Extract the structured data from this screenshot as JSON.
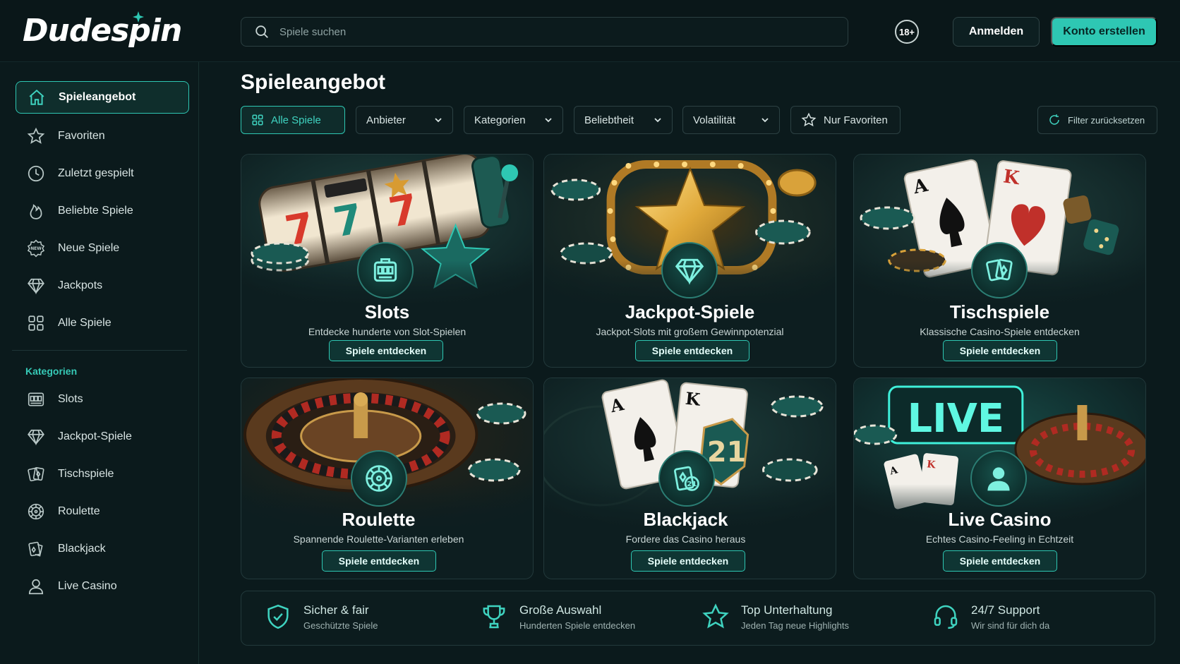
{
  "header": {
    "logo": "Dudespin",
    "search_placeholder": "Spiele suchen",
    "age_badge": "18+",
    "login_label": "Anmelden",
    "register_label": "Konto erstellen"
  },
  "sidebar": {
    "items": [
      {
        "label": "Spieleangebot",
        "icon": "home-icon",
        "active": true
      },
      {
        "label": "Favoriten",
        "icon": "star-icon"
      },
      {
        "label": "Zuletzt gespielt",
        "icon": "clock-icon"
      },
      {
        "label": "Beliebte Spiele",
        "icon": "flame-icon"
      },
      {
        "label": "Neue Spiele",
        "icon": "new-badge-icon"
      },
      {
        "label": "Jackpots",
        "icon": "diamond-icon"
      },
      {
        "label": "Alle Spiele",
        "icon": "grid-icon"
      }
    ],
    "section_title": "Kategorien",
    "categories": [
      {
        "label": "Slots",
        "icon": "slot-machine-icon"
      },
      {
        "label": "Jackpot-Spiele",
        "icon": "diamond-icon"
      },
      {
        "label": "Tischspiele",
        "icon": "cards-icon"
      },
      {
        "label": "Roulette",
        "icon": "roulette-icon"
      },
      {
        "label": "Blackjack",
        "icon": "blackjack-icon"
      },
      {
        "label": "Live Casino",
        "icon": "user-icon"
      }
    ]
  },
  "main": {
    "title": "Spieleangebot",
    "filters": {
      "all_games": "Alle Spiele",
      "provider": "Anbieter",
      "categories": "Kategorien",
      "popularity": "Beliebtheit",
      "volatility": "Volatilität",
      "favorites_only": "Nur Favoriten",
      "reset": "Filter zurücksetzen"
    },
    "cards": [
      {
        "title": "Slots",
        "subtitle": "Entdecke hunderte von Slot-Spielen",
        "cta": "Spiele entdecken",
        "icon": "slot-machine-icon"
      },
      {
        "title": "Jackpot-Spiele",
        "subtitle": "Jackpot-Slots mit großem Gewinnpotenzial",
        "cta": "Spiele entdecken",
        "icon": "diamond-icon"
      },
      {
        "title": "Tischspiele",
        "subtitle": "Klassische Casino-Spiele entdecken",
        "cta": "Spiele entdecken",
        "icon": "cards-icon"
      },
      {
        "title": "Roulette",
        "subtitle": "Spannende Roulette-Varianten erleben",
        "cta": "Spiele entdecken",
        "icon": "roulette-icon"
      },
      {
        "title": "Blackjack",
        "subtitle": "Fordere das Casino heraus",
        "cta": "Spiele entdecken",
        "icon": "blackjack-icon",
        "art_text": "21"
      },
      {
        "title": "Live Casino",
        "subtitle": "Echtes Casino-Feeling in Echtzeit",
        "cta": "Spiele entdecken",
        "icon": "user-icon",
        "art_text": "LIVE"
      }
    ]
  },
  "features": [
    {
      "title": "Sicher & fair",
      "subtitle": "Geschützte Spiele",
      "icon": "shield-check-icon"
    },
    {
      "title": "Große Auswahl",
      "subtitle": "Hunderten Spiele entdecken",
      "icon": "trophy-icon"
    },
    {
      "title": "Top Unterhaltung",
      "subtitle": "Jeden Tag neue Highlights",
      "icon": "star-icon"
    },
    {
      "title": "24/7 Support",
      "subtitle": "Wir sind für dich da",
      "icon": "headset-icon"
    }
  ],
  "colors": {
    "accent": "#2ec7b3",
    "background": "#0b1a1c",
    "card": "#0d1e20",
    "gold": "#e0a93a"
  }
}
